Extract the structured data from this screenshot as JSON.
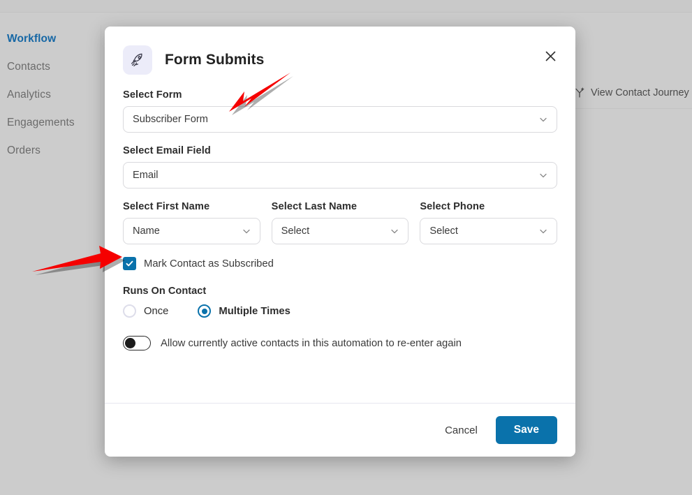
{
  "background": {
    "nav_items": [
      {
        "label": "Workflow",
        "active": true
      },
      {
        "label": "Contacts",
        "active": false
      },
      {
        "label": "Analytics",
        "active": false
      },
      {
        "label": "Engagements",
        "active": false
      },
      {
        "label": "Orders",
        "active": false
      }
    ],
    "view_contact_journey": "View Contact Journey",
    "overlay_color": "#cccccc"
  },
  "modal": {
    "title": "Form Submits",
    "header_icon": "rocket-icon",
    "close_icon": "close-icon",
    "icon_bg": "#ececf9",
    "accent_color": "#0a72ab",
    "fields": [
      {
        "label": "Select Form",
        "value": "Subscriber Form",
        "placeholder": "Select"
      },
      {
        "label": "Select Email Field",
        "value": "Email",
        "placeholder": "Select"
      }
    ],
    "triple_fields": [
      {
        "label": "Select First Name",
        "value": "Name",
        "placeholder": "Select"
      },
      {
        "label": "Select Last Name",
        "value": "Select",
        "placeholder": "Select"
      },
      {
        "label": "Select Phone",
        "value": "Select",
        "placeholder": "Select"
      }
    ],
    "checkbox": {
      "label": "Mark Contact as Subscribed",
      "checked": true
    },
    "runs_on_contact": {
      "label": "Runs On Contact",
      "options": [
        {
          "label": "Once",
          "selected": false
        },
        {
          "label": "Multiple Times",
          "selected": true
        }
      ]
    },
    "toggle": {
      "label": "Allow currently active contacts in this automation to re-enter again",
      "on": false
    },
    "footer": {
      "cancel_label": "Cancel",
      "save_label": "Save"
    }
  },
  "annotations": {
    "arrow_color": "#f50000",
    "arrows": [
      {
        "name": "arrow-pointing-to-select-form",
        "direction": "down-left"
      },
      {
        "name": "arrow-pointing-to-select-first-name",
        "direction": "right"
      }
    ]
  }
}
